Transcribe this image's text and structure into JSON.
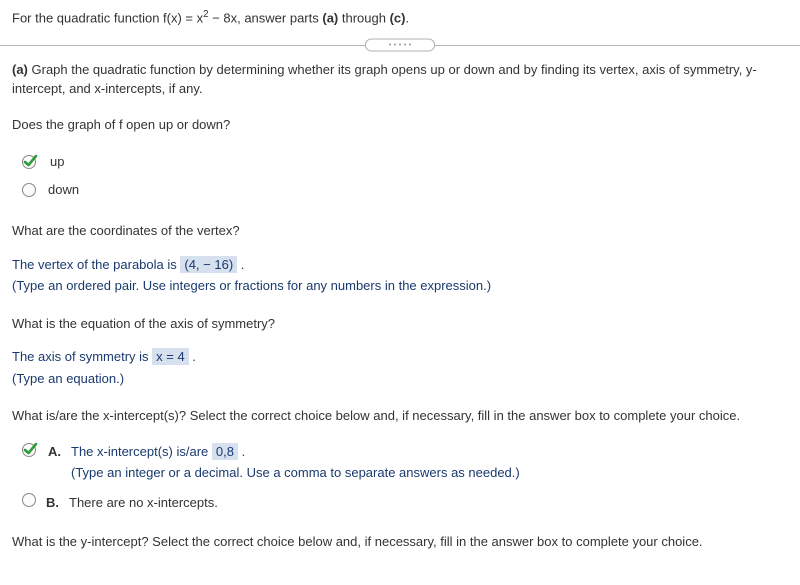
{
  "header": {
    "intro_pre": "For the quadratic function f(x) = x",
    "intro_exp": "2",
    "intro_post": " − 8x, answer parts ",
    "bold_a": "(a)",
    "intro_through": " through ",
    "bold_c": "(c)",
    "period": "."
  },
  "partA": {
    "text_pre": "(a)",
    "text_body": " Graph the quadratic function by determining whether its graph opens up or down and by finding its vertex, axis of symmetry, y-intercept, and x-intercepts, if any."
  },
  "q1": {
    "prompt": "Does the graph of f open up or down?",
    "opt_up": "up",
    "opt_down": "down"
  },
  "q2": {
    "prompt": "What are the coordinates of the vertex?",
    "line_pre": "The vertex of the parabola is ",
    "answer": "(4, − 16)",
    "line_post": " .",
    "hint": "(Type an ordered pair. Use integers or fractions for any numbers in the expression.)"
  },
  "q3": {
    "prompt": "What is the equation of the axis of symmetry?",
    "line_pre": "The axis of symmetry is ",
    "answer": "x = 4",
    "line_post": " .",
    "hint": "(Type an equation.)"
  },
  "q4": {
    "prompt": "What is/are the x-intercept(s)? Select the correct choice below and, if necessary, fill in the answer box to complete your choice.",
    "optA": {
      "letter": "A.",
      "pre": "The x-intercept(s) is/are ",
      "answer": "0,8",
      "post": " .",
      "hint": "(Type an integer or a decimal. Use a comma to separate answers as needed.)"
    },
    "optB": {
      "letter": "B.",
      "text": "There are no x-intercepts."
    }
  },
  "q5": {
    "prompt": "What is the y-intercept? Select the correct choice below and, if necessary, fill in the answer box to complete your choice."
  }
}
